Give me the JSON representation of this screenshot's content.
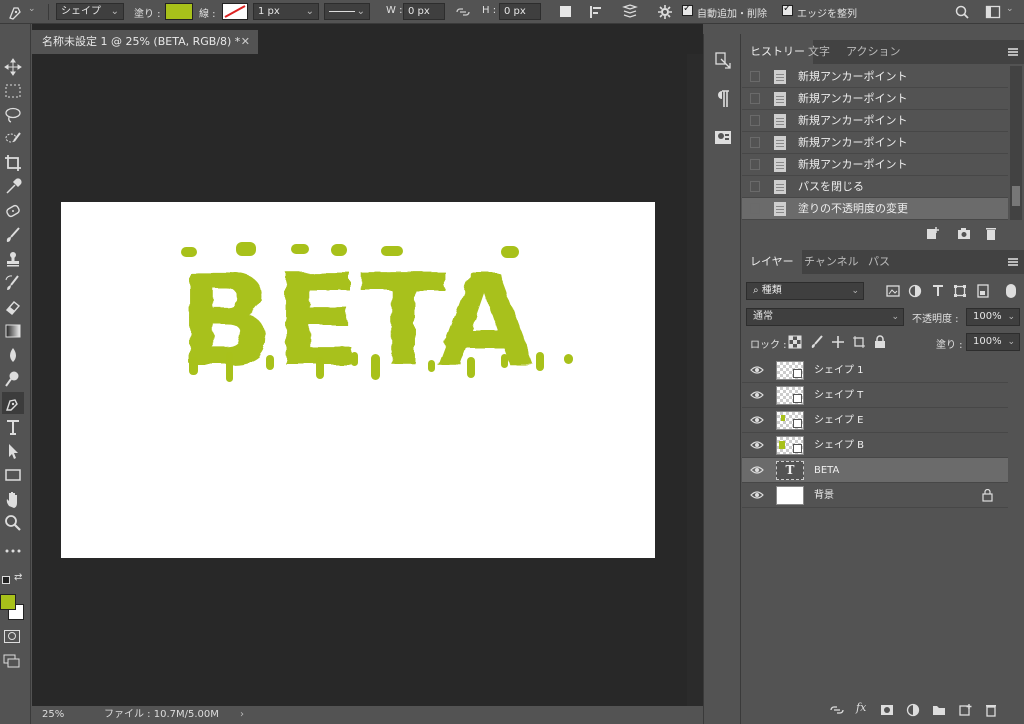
{
  "options_bar": {
    "tool_mode": "シェイプ",
    "fill_label": "塗り :",
    "fill_color": "#a8c11a",
    "stroke_label": "線 :",
    "stroke_width": "1 px",
    "w_label": "W :",
    "w_value": "0 px",
    "h_label": "H :",
    "h_value": "0 px",
    "auto_add_delete": "自動追加・削除",
    "align_edges": "エッジを整列"
  },
  "document": {
    "tab_title": "名称未設定 1 @ 25% (BETA, RGB/8) *",
    "canvas_text": "BETA",
    "canvas_text_color": "#a8c11a",
    "zoom": "25%",
    "file_info": "ファイル : 10.7M/5.00M"
  },
  "history_panel": {
    "tabs": [
      "ヒストリー",
      "文字",
      "アクション"
    ],
    "items": [
      "新規アンカーポイント",
      "新規アンカーポイント",
      "新規アンカーポイント",
      "新規アンカーポイント",
      "新規アンカーポイント",
      "パスを閉じる",
      "塗りの不透明度の変更"
    ]
  },
  "layers_panel": {
    "tabs": [
      "レイヤー",
      "チャンネル",
      "パス"
    ],
    "filter_kind": "種類",
    "blend_mode": "通常",
    "opacity_label": "不透明度 :",
    "opacity_value": "100%",
    "lock_label": "ロック :",
    "fill_label": "塗り :",
    "fill_value": "100%",
    "layers": [
      {
        "name": "シェイプ 1"
      },
      {
        "name": "シェイプ T"
      },
      {
        "name": "シェイプ E"
      },
      {
        "name": "シェイプ B"
      },
      {
        "name": "BETA",
        "thumb_text": "T"
      },
      {
        "name": "背景"
      }
    ]
  },
  "toolbar": {
    "foreground_color": "#a8c11a",
    "background_color": "#ffffff"
  }
}
